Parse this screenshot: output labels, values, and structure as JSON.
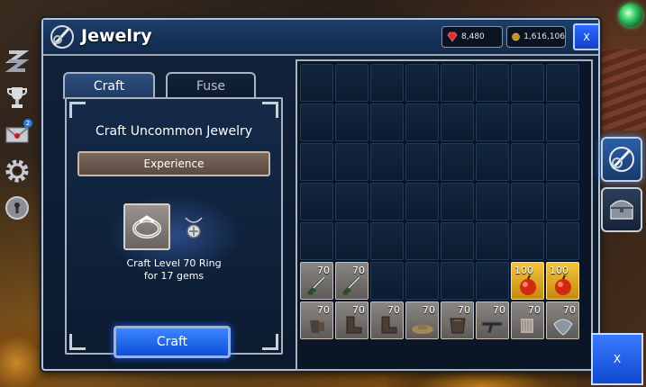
{
  "window": {
    "title": "Jewelry"
  },
  "currency": {
    "gems": "8,480",
    "gold": "1,616,106"
  },
  "buttons": {
    "close_top": "X",
    "close_corner": "X",
    "craft": "Craft"
  },
  "tabs": [
    {
      "label": "Craft",
      "active": true
    },
    {
      "label": "Fuse",
      "active": false
    }
  ],
  "craft_panel": {
    "title": "Craft Uncommon Jewelry",
    "experience_label": "Experience",
    "description_line1": "Craft Level 70 Ring",
    "description_line2": "for 17 gems"
  },
  "inventory": {
    "rows": 7,
    "columns": 8,
    "items": [
      {
        "slot": 40,
        "level": "70",
        "icon": "sword-icon",
        "type": "item"
      },
      {
        "slot": 41,
        "level": "70",
        "icon": "sword-icon",
        "type": "item"
      },
      {
        "slot": 46,
        "level": "100",
        "icon": "apple-icon",
        "type": "gold"
      },
      {
        "slot": 47,
        "level": "100",
        "icon": "apple-icon",
        "type": "gold"
      },
      {
        "slot": 48,
        "level": "70",
        "icon": "gauntlets-icon",
        "type": "item"
      },
      {
        "slot": 49,
        "level": "70",
        "icon": "boots-icon",
        "type": "item"
      },
      {
        "slot": 50,
        "level": "70",
        "icon": "boots-icon",
        "type": "item"
      },
      {
        "slot": 51,
        "level": "70",
        "icon": "hat-icon",
        "type": "item"
      },
      {
        "slot": 52,
        "level": "70",
        "icon": "armor-icon",
        "type": "item"
      },
      {
        "slot": 53,
        "level": "70",
        "icon": "gun-icon",
        "type": "item"
      },
      {
        "slot": 54,
        "level": "70",
        "icon": "gloves-icon",
        "type": "item"
      },
      {
        "slot": 55,
        "level": "70",
        "icon": "shield-icon",
        "type": "item"
      }
    ]
  },
  "colors": {
    "accent": "#1a5cff",
    "panel": "#0c1b30",
    "gold_slot": "#f4c43a"
  }
}
